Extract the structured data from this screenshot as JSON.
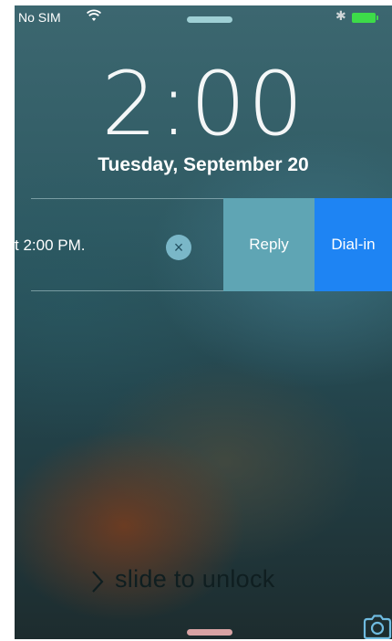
{
  "status_bar": {
    "carrier": "No SIM",
    "wifi_icon": "wifi-icon",
    "bluetooth_icon": "bluetooth-icon",
    "battery_icon": "battery-icon",
    "battery_color": "#3ddb49"
  },
  "lock_screen": {
    "time": "2:00",
    "date": "Tuesday, September 20"
  },
  "notification": {
    "text": "t 2:00 PM.",
    "clear_icon": "close-circle-icon",
    "actions": [
      {
        "label": "Reply",
        "color": "#5fa5b4"
      },
      {
        "label": "Dial-in",
        "color": "#1e84f3"
      }
    ]
  },
  "unlock": {
    "label": "slide to unlock",
    "chevron_icon": "chevron-right-icon",
    "camera_icon": "camera-icon"
  }
}
